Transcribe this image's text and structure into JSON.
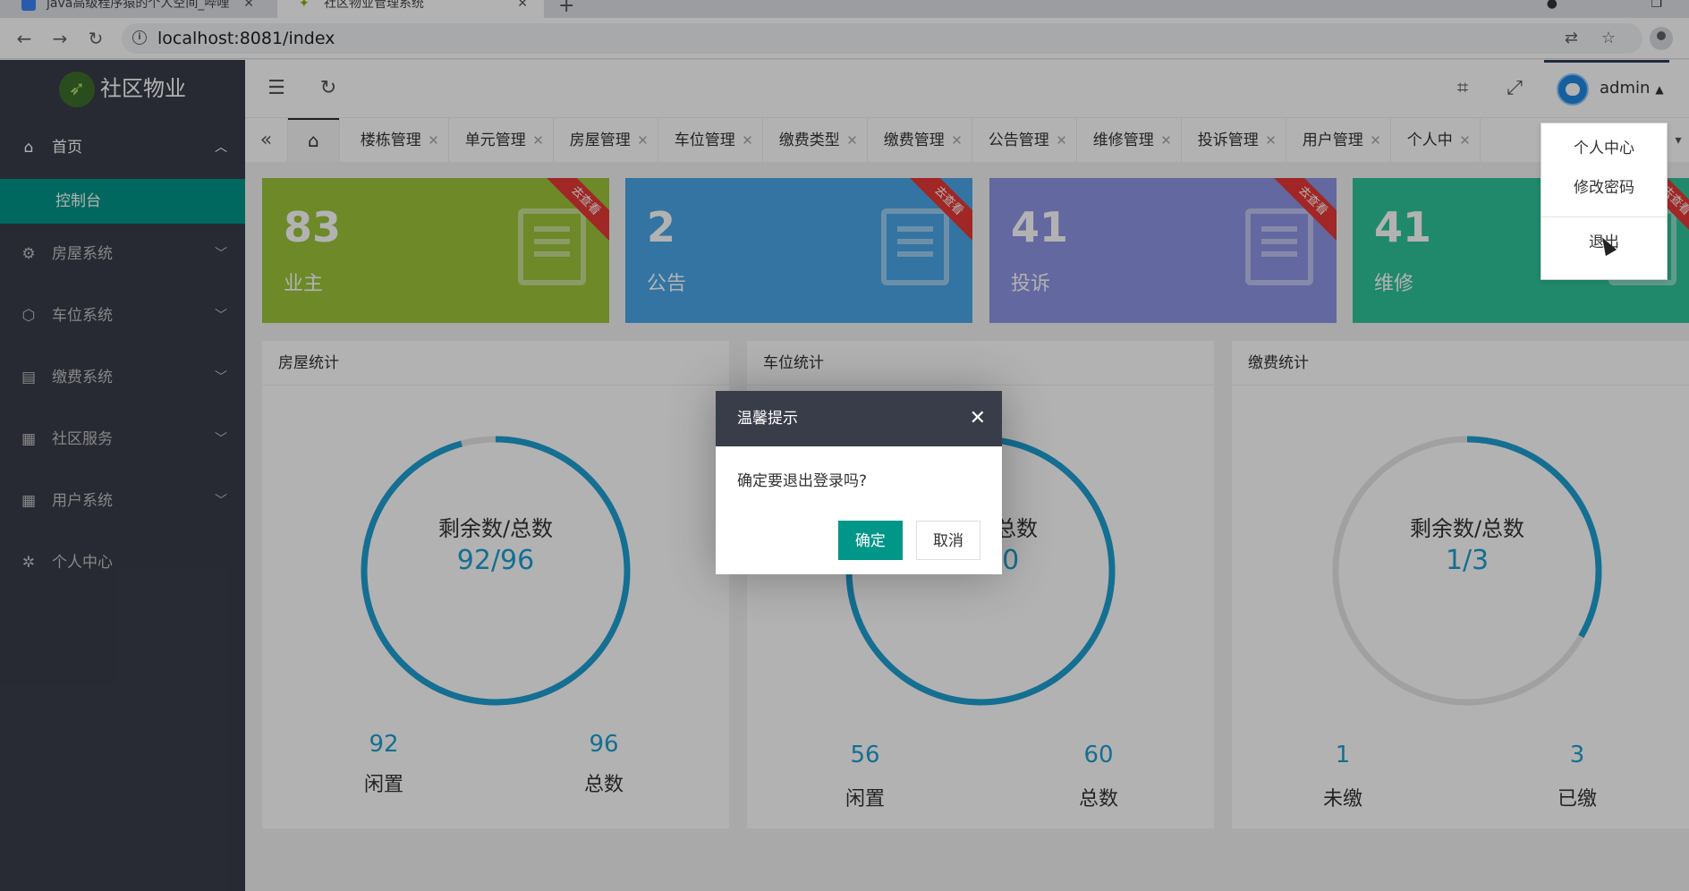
{
  "browser": {
    "tabs": [
      {
        "title": "java高级程序猿的个人空间_哔哩"
      },
      {
        "title": "社区物业管理系统"
      }
    ],
    "url": "localhost:8081/index"
  },
  "brand": {
    "name": "社区物业"
  },
  "sidebar": {
    "items": [
      {
        "label": "首页",
        "icon": "home-icon"
      },
      {
        "label": "房屋系统",
        "icon": "gear-icon"
      },
      {
        "label": "车位系统",
        "icon": "cube-icon"
      },
      {
        "label": "缴费系统",
        "icon": "building-icon"
      },
      {
        "label": "社区服务",
        "icon": "grid-icon"
      },
      {
        "label": "用户系统",
        "icon": "grid-icon"
      },
      {
        "label": "个人中心",
        "icon": "gear-icon"
      }
    ],
    "sub_active": "控制台"
  },
  "header": {
    "username": "admin"
  },
  "page_tabs": [
    "楼栋管理",
    "单元管理",
    "房屋管理",
    "车位管理",
    "缴费类型",
    "缴费管理",
    "公告管理",
    "维修管理",
    "投诉管理",
    "用户管理",
    "个人中"
  ],
  "cards": [
    {
      "value": "83",
      "label": "业主",
      "color": "#9cc53a",
      "ribbon": "去查看"
    },
    {
      "value": "2",
      "label": "公告",
      "color": "#4ba6e8",
      "ribbon": "去查看"
    },
    {
      "value": "41",
      "label": "投诉",
      "color": "#8e96e6",
      "ribbon": "去查看"
    },
    {
      "value": "41",
      "label": "维修",
      "color": "#2ec59a",
      "ribbon": "去查看"
    }
  ],
  "panels": [
    {
      "title": "房屋统计",
      "ring_label": "剩余数/总数",
      "ring_value": "92/96",
      "ratio": 0.958,
      "left_num": "92",
      "left_label": "闲置",
      "right_num": "96",
      "right_label": "总数"
    },
    {
      "title": "车位统计",
      "ring_label": "剩余数/总数",
      "ring_value": "56/60",
      "ratio": 0.933,
      "left_num": "56",
      "left_label": "闲置",
      "right_num": "60",
      "right_label": "总数"
    },
    {
      "title": "缴费统计",
      "ring_label": "剩余数/总数",
      "ring_value": "1/3",
      "ratio": 0.333,
      "left_num": "1",
      "left_label": "未缴",
      "right_num": "3",
      "right_label": "已缴"
    }
  ],
  "user_menu": {
    "items": [
      "个人中心",
      "修改密码"
    ],
    "logout": "退出"
  },
  "dialog": {
    "title": "温馨提示",
    "message": "确定要退出登录吗?",
    "confirm": "确定",
    "cancel": "取消"
  },
  "colors": {
    "accent": "#009688",
    "ring": "#1e9fd1",
    "ring_track": "#e6e6e6",
    "sidebar_bg": "#393d49"
  }
}
